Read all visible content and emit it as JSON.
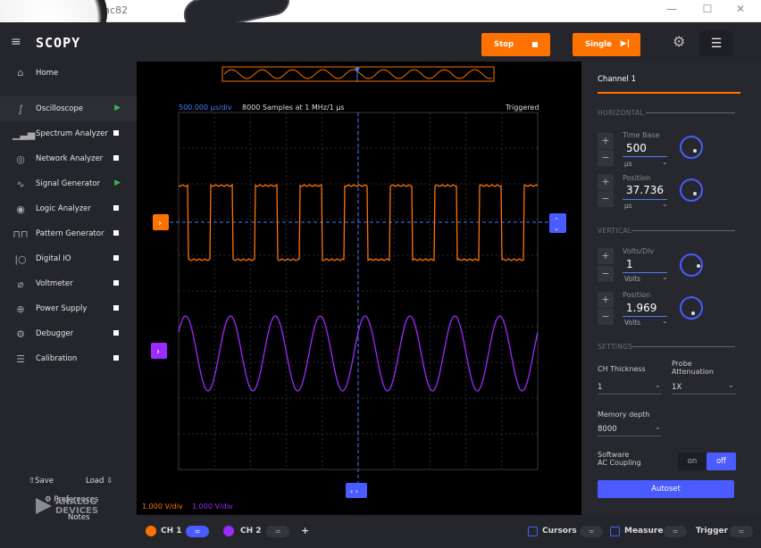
{
  "window": {
    "title": "y - a55ac82",
    "minimize": "—",
    "maximize": "☐",
    "close": "✕"
  },
  "app": {
    "logo": "SCOPY",
    "menu_icon": "≡"
  },
  "sidebar": {
    "home": {
      "label": "Home",
      "icon": "home-icon"
    },
    "items": [
      {
        "label": "Oscilloscope",
        "status": "running"
      },
      {
        "label": "Spectrum Analyzer",
        "status": "stopped"
      },
      {
        "label": "Network Analyzer",
        "status": "stopped"
      },
      {
        "label": "Signal Generator",
        "status": "running"
      },
      {
        "label": "Logic Analyzer",
        "status": "stopped"
      },
      {
        "label": "Pattern Generator",
        "status": "stopped"
      },
      {
        "label": "Digital IO",
        "status": "stopped"
      },
      {
        "label": "Voltmeter",
        "status": "stopped"
      },
      {
        "label": "Power Supply",
        "status": "stopped"
      },
      {
        "label": "Debugger",
        "status": "stopped"
      },
      {
        "label": "Calibration",
        "status": "stopped"
      }
    ],
    "save": "Save",
    "load": "Load",
    "preferences": "Preferences",
    "notes": "Notes",
    "brand_line1": "ANALOG",
    "brand_line2": "DEVICES"
  },
  "toolbar": {
    "stop": "Stop",
    "single": "Single"
  },
  "plot": {
    "timebase_label": "500.000 µs/div",
    "samples_label": "8000 Samples at 1 MHz/1 µs",
    "trigger_status": "Triggered",
    "ch1_scale": "1.000 V/div",
    "ch2_scale": "1.000 V/div",
    "colors": {
      "ch1": "#ff7200",
      "ch2": "#9b2cff",
      "accent": "#4a5bff",
      "cursor": "#4a7cff"
    }
  },
  "panel": {
    "channel_title": "Channel 1",
    "horizontal": "HORIZONTAL",
    "vertical": "VERTICAL",
    "settings": "SETTINGS",
    "time_base": {
      "label": "Time Base",
      "value": "500",
      "unit": "µs"
    },
    "h_position": {
      "label": "Position",
      "value": "37.736",
      "unit": "µs"
    },
    "volts_div": {
      "label": "Volts/Div",
      "value": "1",
      "unit": "Volts"
    },
    "v_position": {
      "label": "Position",
      "value": "1.969",
      "unit": "Volts"
    },
    "ch_thickness": {
      "label": "CH Thickness",
      "value": "1"
    },
    "probe": {
      "label_line1": "Probe",
      "label_line2": "Attenuation",
      "value": "1X"
    },
    "memory": {
      "label": "Memory depth",
      "value": "8000"
    },
    "ac_coupling": {
      "label_line1": "Software",
      "label_line2": "AC Coupling",
      "on": "on",
      "off": "off"
    },
    "autoset": "Autoset"
  },
  "bottom": {
    "ch1": "CH 1",
    "ch2": "CH 2",
    "add": "+",
    "cursors": "Cursors",
    "measure": "Measure",
    "trigger": "Trigger"
  }
}
